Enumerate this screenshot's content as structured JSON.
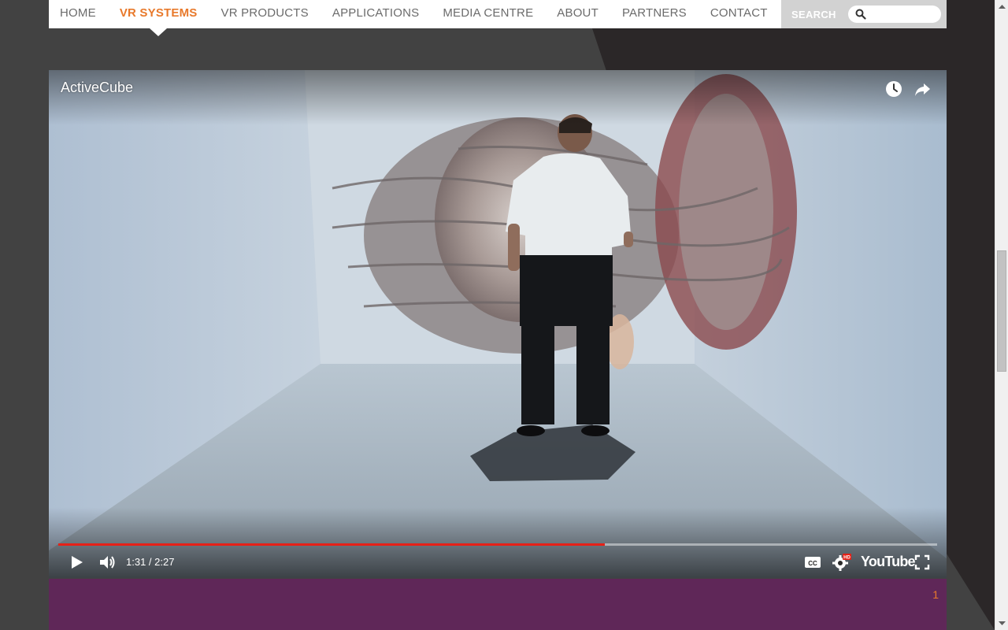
{
  "nav": {
    "items": [
      {
        "label": "HOME",
        "active": false
      },
      {
        "label": "VR SYSTEMS",
        "active": true
      },
      {
        "label": "VR PRODUCTS",
        "active": false
      },
      {
        "label": "APPLICATIONS",
        "active": false
      },
      {
        "label": "MEDIA CENTRE",
        "active": false
      },
      {
        "label": "ABOUT",
        "active": false
      },
      {
        "label": "PARTNERS",
        "active": false
      },
      {
        "label": "CONTACT",
        "active": false
      }
    ],
    "search_label": "SEARCH",
    "search_value": "",
    "active_color": "#e8792b"
  },
  "video": {
    "title": "ActiveCube",
    "current_time": "1:31",
    "duration": "2:27",
    "time_display": "1:31 / 2:27",
    "progress_fraction": 0.622,
    "logo": "YouTube",
    "icons": [
      "watch-later-icon",
      "share-icon",
      "play-icon",
      "volume-icon",
      "captions-icon",
      "settings-hd-icon",
      "fullscreen-icon"
    ],
    "settings_badge": "HD",
    "cc_label": "CC",
    "progress_color": "#e62117"
  },
  "panel": {
    "page_number": "1",
    "color": "#5f2758"
  }
}
